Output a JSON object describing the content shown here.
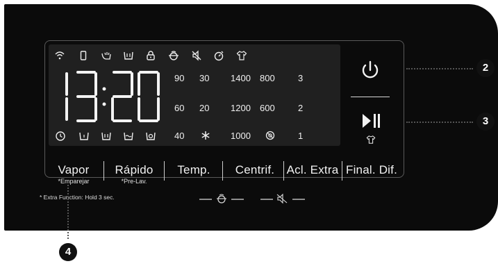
{
  "display": {
    "time": "13:20",
    "temps": [
      "90",
      "60",
      "40"
    ],
    "temps2": [
      "30",
      "20"
    ],
    "spin": [
      "1400",
      "1200",
      "1000"
    ],
    "spin2": [
      "800",
      "600"
    ],
    "rinse": [
      "3",
      "2",
      "1"
    ]
  },
  "buttons": {
    "vapor": "Vapor",
    "vapor_sub": "*Emparejar",
    "rapido": "Rápido",
    "rapido_sub": "*Pre-Lav.",
    "temp": "Temp.",
    "centrif": "Centrif.",
    "acl_extra": "Acl. Extra",
    "final_dif": "Final. Dif."
  },
  "note": "* Extra Function: Hold 3 sec.",
  "callouts": {
    "c2": "2",
    "c3": "3",
    "c4": "4"
  },
  "icons": {
    "top_row": [
      "wifi-icon",
      "smartphone-icon",
      "wash-hand-icon",
      "tub-icon",
      "lock-icon",
      "child-lock-icon",
      "mute-icon",
      "timer-icon",
      "shirt-icon"
    ],
    "bottom_row": [
      "clock-icon",
      "tub-wash-icon",
      "tub-wash2-icon",
      "rinse-icon",
      "spin-icon"
    ]
  },
  "colors": {
    "panel": "#0b0b0b",
    "display": "#202020",
    "text": "#f0f0f0",
    "frame": "#5a5a5a"
  }
}
